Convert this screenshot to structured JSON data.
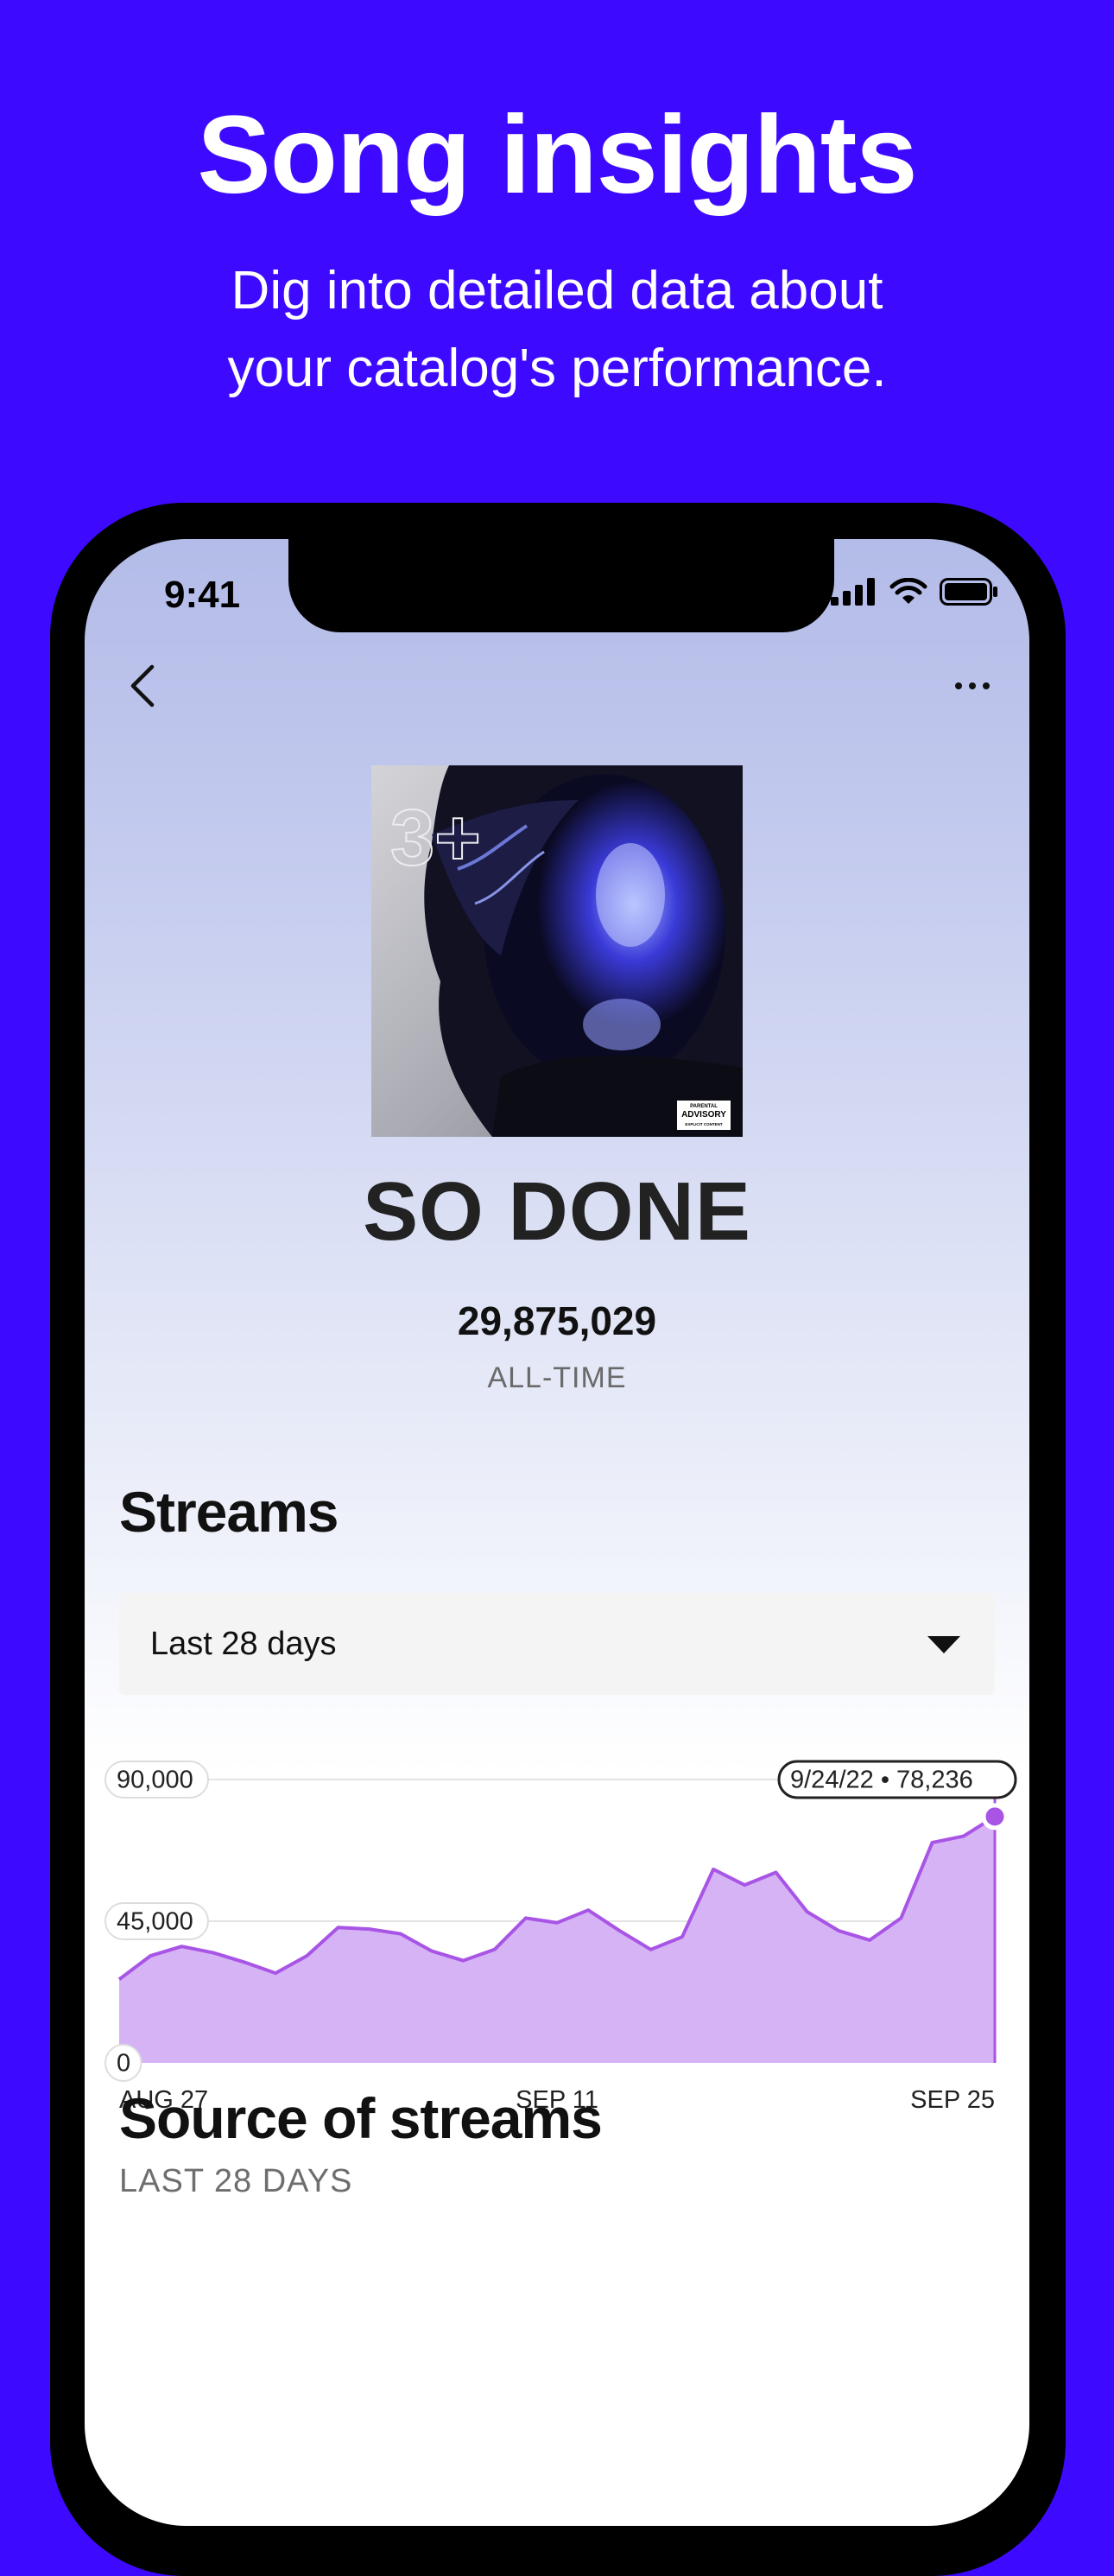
{
  "promo": {
    "headline": "Song insights",
    "subline_1": "Dig into detailed data about",
    "subline_2": "your catalog's performance."
  },
  "status_bar": {
    "time": "9:41"
  },
  "nav": {
    "back_icon": "chevron-left-icon",
    "more_icon": "ellipsis-icon"
  },
  "song": {
    "title": "SO DONE",
    "total_streams": "29,875,029",
    "total_label": "ALL-TIME",
    "artwork_text": "3+",
    "advisory_label_1": "PARENTAL",
    "advisory_label_2": "ADVISORY",
    "advisory_label_3": "EXPLICIT CONTENT"
  },
  "streams_section": {
    "title": "Streams",
    "range_selected": "Last 28 days"
  },
  "chart_data": {
    "type": "area",
    "x": [
      "2022-08-27",
      "2022-08-28",
      "2022-08-29",
      "2022-08-30",
      "2022-08-31",
      "2022-09-01",
      "2022-09-02",
      "2022-09-03",
      "2022-09-04",
      "2022-09-05",
      "2022-09-06",
      "2022-09-07",
      "2022-09-08",
      "2022-09-09",
      "2022-09-10",
      "2022-09-11",
      "2022-09-12",
      "2022-09-13",
      "2022-09-14",
      "2022-09-15",
      "2022-09-16",
      "2022-09-17",
      "2022-09-18",
      "2022-09-19",
      "2022-09-20",
      "2022-09-21",
      "2022-09-22",
      "2022-09-23",
      "2022-09-24"
    ],
    "values": [
      26500,
      34000,
      37000,
      35000,
      32000,
      28500,
      34000,
      43000,
      42500,
      41000,
      35500,
      32500,
      36000,
      46000,
      44500,
      48500,
      42000,
      36000,
      40000,
      61500,
      56500,
      60500,
      48000,
      42000,
      39000,
      46000,
      70000,
      72000,
      78236
    ],
    "ylim": [
      0,
      90000
    ],
    "ytick_labels": [
      "90,000",
      "45,000",
      "0"
    ],
    "xtick_labels": [
      "AUG 27",
      "SEP 11",
      "SEP 25"
    ],
    "tooltip": "9/24/22 • 78,236",
    "color": "#a855e6",
    "fill_color": "#d6b3f5",
    "grid": true
  },
  "source_section": {
    "title": "Source of streams",
    "subtitle": "LAST 28 DAYS"
  },
  "colors": {
    "background": "#3d0aff",
    "accent": "#a855e6"
  }
}
